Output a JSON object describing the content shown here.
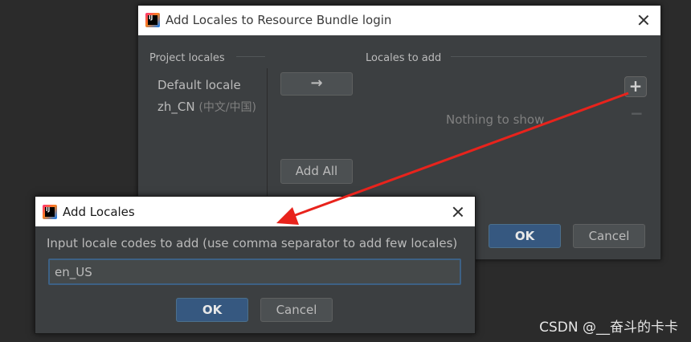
{
  "main_dialog": {
    "title": "Add Locales to Resource Bundle login",
    "project_locales_label": "Project locales",
    "locales_to_add_label": "Locales to add",
    "project_locales": [
      {
        "code": "Default locale",
        "hint": ""
      },
      {
        "code": "zh_CN",
        "hint": "(中文/中国)"
      }
    ],
    "move_button_glyph": "→",
    "add_all_label": "Add All",
    "empty_text": "Nothing to show",
    "add_icon_glyph": "+",
    "remove_icon_glyph": "−",
    "ok_label": "OK",
    "cancel_label": "Cancel"
  },
  "sub_dialog": {
    "title": "Add Locales",
    "prompt": "Input locale codes to add (use comma separator to add few locales)",
    "input_value": "en_US",
    "ok_label": "OK",
    "cancel_label": "Cancel"
  },
  "app_icon_text": "IJ",
  "annotation": {
    "arrow_color": "#e8231c"
  },
  "watermark": "CSDN @__奋斗的卡卡",
  "colors": {
    "dialog_bg": "#3c3f41",
    "primary_button": "#365880",
    "text": "#bbbbbb"
  }
}
